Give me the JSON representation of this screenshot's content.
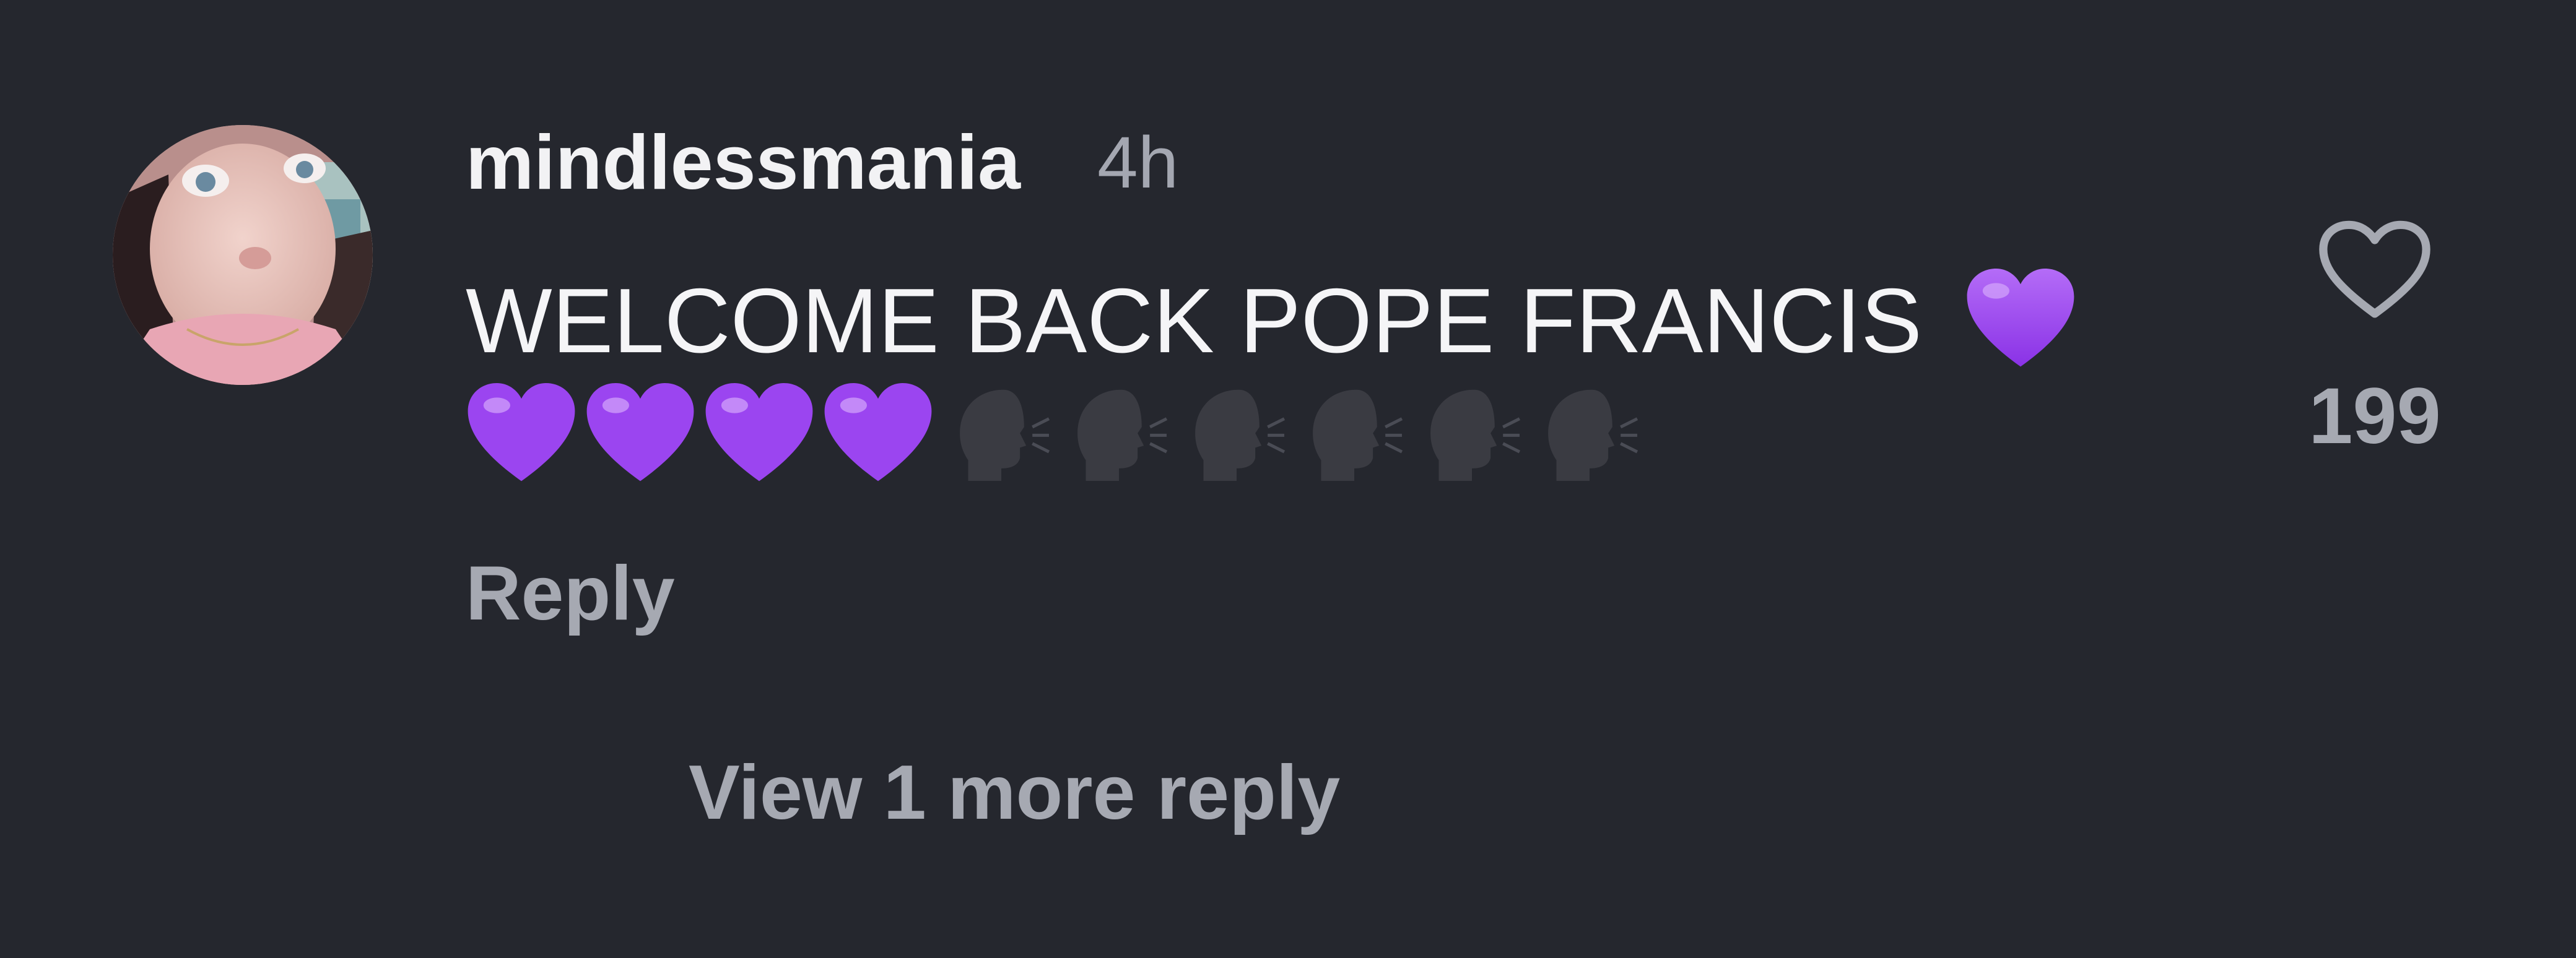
{
  "comment": {
    "author": {
      "username": "mindlessmania",
      "avatar_icon": "user-avatar-photo"
    },
    "timestamp": "4h",
    "text": "WELCOME BACK POPE FRANCIS",
    "emojis": [
      "purple-heart",
      "purple-heart",
      "purple-heart",
      "purple-heart",
      "purple-heart",
      "speaking-head",
      "speaking-head",
      "speaking-head",
      "speaking-head",
      "speaking-head",
      "speaking-head"
    ],
    "reply_label": "Reply",
    "view_replies_label": "View 1 more reply",
    "likes": {
      "icon": "heart-outline-icon",
      "count": "199"
    }
  },
  "colors": {
    "background": "#25272e",
    "primary_text": "#f5f5f7",
    "secondary_text": "#a6a9b2",
    "purple_heart": "#9b45f0",
    "speaking_head": "#3a3b42"
  }
}
